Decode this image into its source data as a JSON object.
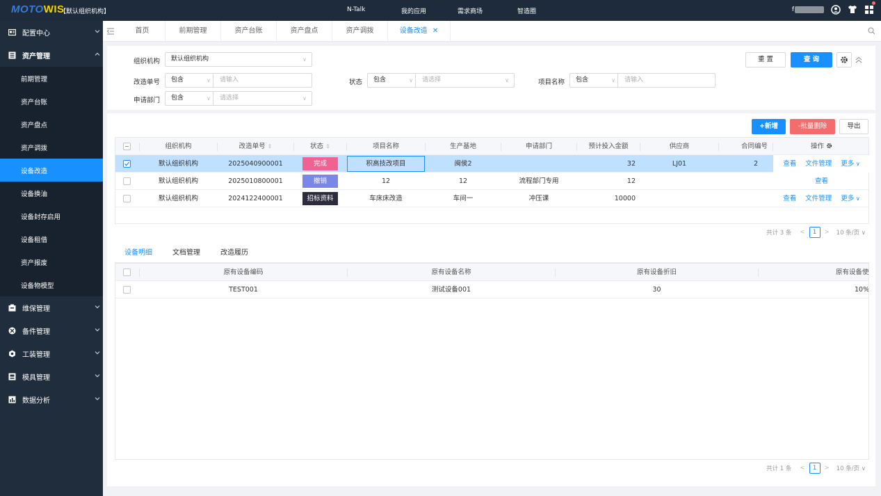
{
  "app": {
    "logo_part1": "MOTO",
    "logo_part2": "WIS",
    "org_name": "【默认组织机构】",
    "top_nav": [
      "N-Talk",
      "我的应用",
      "需求商场",
      "智造圈"
    ],
    "user_name": "f"
  },
  "sidebar": {
    "groups_top": [
      {
        "label": "配置中心",
        "icon": "config-icon"
      },
      {
        "label": "资产管理",
        "icon": "asset-list-icon"
      }
    ],
    "sub_items": [
      "前期管理",
      "资产台账",
      "资产盘点",
      "资产调拨",
      "设备改造",
      "设备换油",
      "设备封存启用",
      "设备租借",
      "资产报废",
      "设备物模型"
    ],
    "active_sub": "设备改造",
    "groups_bottom": [
      {
        "label": "维保管理",
        "icon": "maintenance-icon"
      },
      {
        "label": "备件管理",
        "icon": "spare-parts-icon"
      },
      {
        "label": "工装管理",
        "icon": "tooling-icon"
      },
      {
        "label": "模具管理",
        "icon": "mold-icon"
      },
      {
        "label": "数据分析",
        "icon": "chart-icon"
      }
    ]
  },
  "tabs": [
    "首页",
    "前期管理",
    "资产台账",
    "资产盘点",
    "资产调拨",
    "设备改造"
  ],
  "active_tab": "设备改造",
  "filter": {
    "org_label": "组织机构",
    "org_value": "默认组织机构",
    "no_label": "改造单号",
    "no_op": "包含",
    "no_placeholder": "请输入",
    "status_label": "状态",
    "status_op": "包含",
    "status_placeholder": "请选择",
    "project_label": "项目名称",
    "project_op": "包含",
    "project_placeholder": "请输入",
    "dept_label": "申请部门",
    "dept_op": "包含",
    "dept_placeholder": "请选择",
    "reset_label": "重 置",
    "query_label": "查 询"
  },
  "toolbar": {
    "add_label": "+新增",
    "batch_delete_label": "-批量删除",
    "export_label": "导出"
  },
  "main_table": {
    "headers": [
      "组织机构",
      "改造单号",
      "状态",
      "项目名称",
      "生产基地",
      "申请部门",
      "预计投入金额",
      "供应商",
      "合同编号",
      "操作"
    ],
    "rows": [
      {
        "org": "默认组织机构",
        "no": "2025040900001",
        "status": "完成",
        "status_color": "#f06292",
        "project": "积高技改项目",
        "base": "闽侯2",
        "dept": "",
        "amount": "32",
        "supplier": "LJ01",
        "contract": "2",
        "actions": [
          "查看",
          "文件管理",
          "更多"
        ],
        "selected": true
      },
      {
        "org": "默认组织机构",
        "no": "2025010800001",
        "status": "撤销",
        "status_color": "#7b86e8",
        "project": "12",
        "base": "12",
        "dept": "流程部门专用",
        "amount": "12",
        "supplier": "",
        "contract": "",
        "actions": [
          "查看"
        ],
        "selected": false
      },
      {
        "org": "默认组织机构",
        "no": "2024122400001",
        "status": "招标资料",
        "status_color": "#2c2c3c",
        "project": "车床床改造",
        "base": "车间一",
        "dept": "冲压课",
        "amount": "10000",
        "supplier": "",
        "contract": "",
        "actions": [
          "查看",
          "文件管理",
          "更多"
        ],
        "selected": false
      }
    ],
    "total_text": "共计 3 条",
    "page": "1",
    "page_size": "10 条/页"
  },
  "detail_tabs": [
    "设备明细",
    "文档管理",
    "改造履历"
  ],
  "active_detail_tab": "设备明细",
  "detail_table": {
    "headers": [
      "原有设备编码",
      "原有设备名称",
      "原有设备折旧",
      "原有设备使"
    ],
    "rows": [
      {
        "code": "TEST001",
        "name": "测试设备001",
        "depreciation": "30",
        "usage": "10%"
      }
    ],
    "total_text": "共计 1 条",
    "page": "1",
    "page_size": "10 条/页"
  },
  "colors": {
    "primary": "#1890ff",
    "sidebar_bg": "#1f2d3d",
    "topbar_bg": "#1d2b3a",
    "danger": "#f56c6c"
  }
}
